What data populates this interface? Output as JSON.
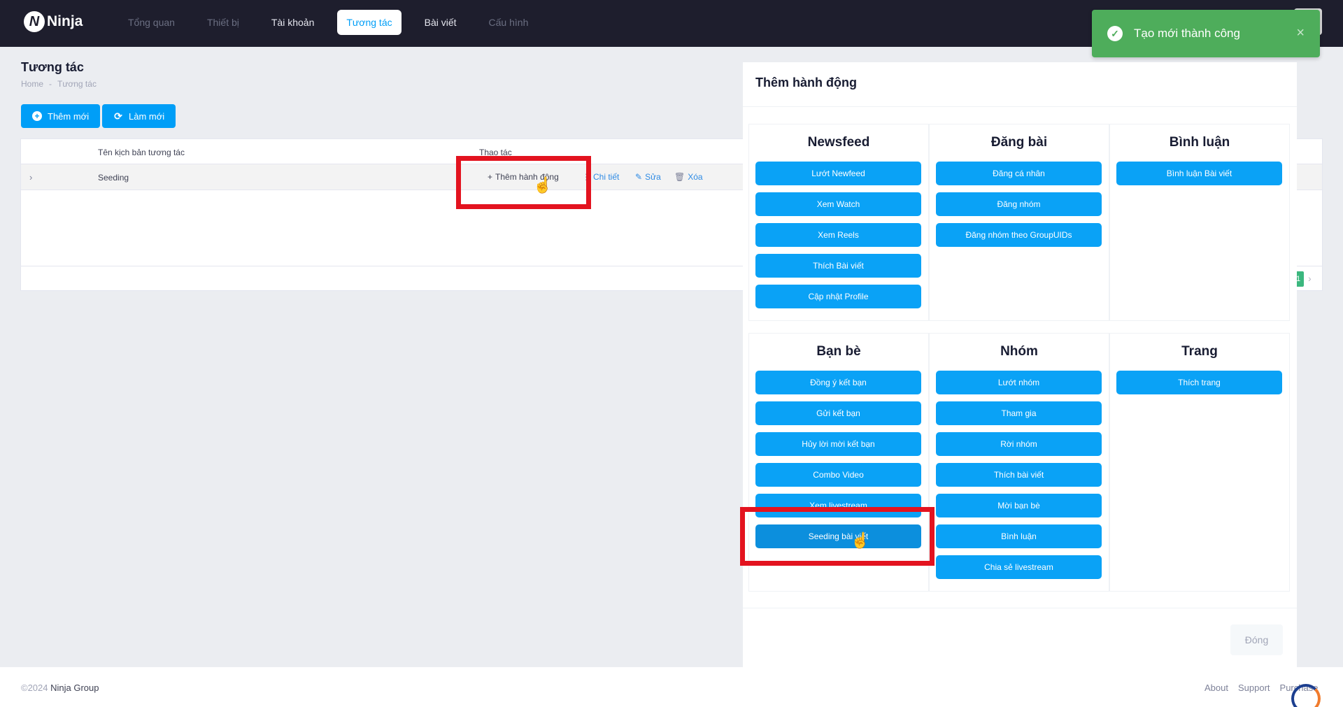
{
  "app": {
    "logo_letter": "N",
    "logo_text": "Ninja"
  },
  "nav": [
    {
      "label": "Tổng quan"
    },
    {
      "label": "Thiết bị"
    },
    {
      "label": "Tài khoản"
    },
    {
      "label": "Tương tác"
    },
    {
      "label": "Bài viết"
    },
    {
      "label": "Cấu hình"
    }
  ],
  "toast": {
    "message": "Tạo mới thành công",
    "close": "×",
    "check": "✓"
  },
  "page": {
    "title": "Tương tác",
    "breadcrumb": [
      "Home",
      "-",
      "Tương tác"
    ],
    "add_button": "Thêm mới",
    "refresh_button": "Làm mới"
  },
  "table": {
    "headers": {
      "name": "Tên kịch bản tương tác",
      "actions": "Thao tác"
    },
    "rows": [
      {
        "name": "Seeding",
        "add_action": "Thêm hành động",
        "detail": "Chi tiết",
        "edit": "Sửa",
        "delete": "Xóa"
      }
    ],
    "pager_current": "1"
  },
  "modal": {
    "title": "Thêm hành động",
    "close_label": "Đóng",
    "groups": [
      {
        "title": "Newsfeed",
        "actions": [
          "Lướt Newfeed",
          "Xem Watch",
          "Xem Reels",
          "Thích Bài viết",
          "Cập nhật Profile"
        ]
      },
      {
        "title": "Đăng bài",
        "actions": [
          "Đăng cá nhân",
          "Đăng nhóm",
          "Đăng nhóm theo GroupUIDs"
        ]
      },
      {
        "title": "Bình luận",
        "actions": [
          "Bình luận Bài viết"
        ]
      },
      {
        "title": "Bạn bè",
        "actions": [
          "Đồng ý kết bạn",
          "Gửi kết bạn",
          "Hủy lời mời kết bạn",
          "Combo Video",
          "Xem livestream",
          "Seeding bài viết"
        ]
      },
      {
        "title": "Nhóm",
        "actions": [
          "Lướt nhóm",
          "Tham gia",
          "Rời nhóm",
          "Thích bài viết",
          "Mời bạn bè",
          "Bình luận",
          "Chia sẻ livestream"
        ]
      },
      {
        "title": "Trang",
        "actions": [
          "Thích trang"
        ]
      }
    ]
  },
  "footer": {
    "copyright": "©2024",
    "company": "Ninja Group",
    "links": [
      "About",
      "Support",
      "Purchase"
    ]
  },
  "colors": {
    "primary": "#009ef7",
    "toast": "#4ead5b",
    "highlight": "#e3131f",
    "navbar": "#1e1e2d"
  }
}
